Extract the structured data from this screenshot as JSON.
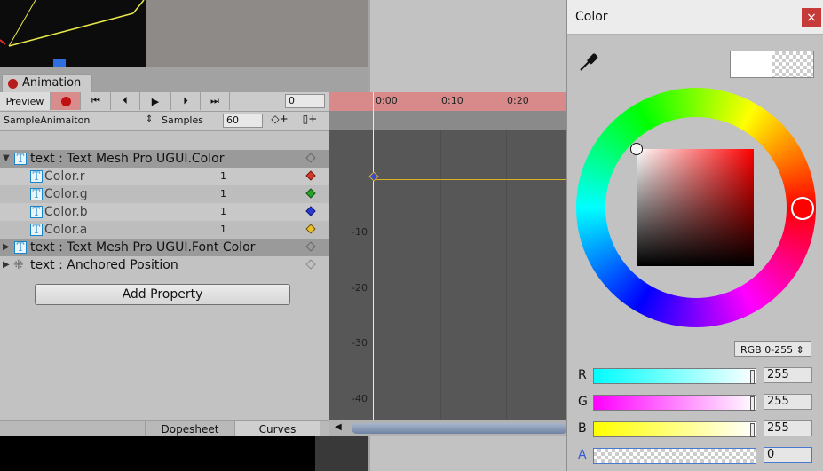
{
  "animation": {
    "tab_label": "Animation",
    "toolbar": {
      "preview_label": "Preview",
      "frame_value": "0",
      "clip_name": "SampleAnimaiton",
      "samples_label": "Samples",
      "samples_value": "60"
    },
    "ruler_ticks": [
      "0:00",
      "0:10",
      "0:20"
    ],
    "y_axis_ticks": [
      "-10",
      "-20",
      "-30",
      "-40"
    ],
    "properties": [
      {
        "label": "text : Text Mesh Pro UGUI.Color",
        "type": "group",
        "expanded": true,
        "icon": "tmp-text-icon"
      },
      {
        "label": "Color.r",
        "type": "child",
        "value": "1",
        "key_color": "#d03a2a"
      },
      {
        "label": "Color.g",
        "type": "child",
        "value": "1",
        "key_color": "#2aa02a"
      },
      {
        "label": "Color.b",
        "type": "child",
        "value": "1",
        "key_color": "#2a3ad0"
      },
      {
        "label": "Color.a",
        "type": "child",
        "value": "1",
        "key_color": "#e8c02a"
      },
      {
        "label": "text : Text Mesh Pro UGUI.Font Color",
        "type": "group",
        "expanded": false,
        "icon": "tmp-text-icon"
      },
      {
        "label": "text : Anchored Position",
        "type": "group",
        "expanded": false,
        "icon": "rect-transform-icon"
      }
    ],
    "add_property_label": "Add Property",
    "bottom_tabs": [
      "Dopesheet",
      "Curves"
    ]
  },
  "color_picker": {
    "title": "Color",
    "close_label": "×",
    "mode": "RGB 0-255 ⇕",
    "channels": [
      {
        "label": "R",
        "value": "255",
        "gradient": "linear-gradient(to right,#00ffff,#ffffff)"
      },
      {
        "label": "G",
        "value": "255",
        "gradient": "linear-gradient(to right,#ff00ff,#ffffff)"
      },
      {
        "label": "B",
        "value": "255",
        "gradient": "linear-gradient(to right,#ffff00,#ffffff)"
      },
      {
        "label": "A",
        "value": "0",
        "gradient": "checker"
      }
    ]
  },
  "colors": {
    "record_red": "#c01010",
    "accent_blue": "#1a86c8",
    "close_red": "#c63a3a"
  }
}
